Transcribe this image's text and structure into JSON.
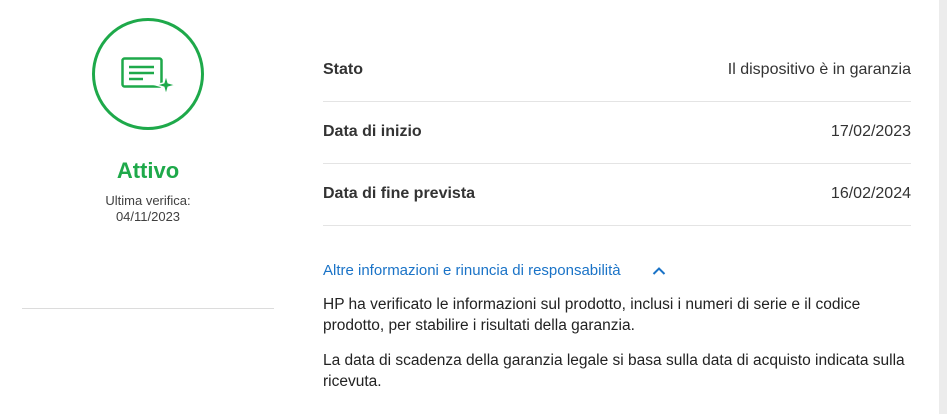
{
  "status": {
    "title": "Attivo",
    "last_check_label": "Ultima verifica:",
    "last_check_date": "04/11/2023",
    "icon": "warranty-certificate-icon",
    "accent": "#1ea94a"
  },
  "details": [
    {
      "label": "Stato",
      "value": "Il dispositivo è in garanzia"
    },
    {
      "label": "Data di inizio",
      "value": "17/02/2023"
    },
    {
      "label": "Data di fine prevista",
      "value": "16/02/2024"
    }
  ],
  "more_info": {
    "link_label": "Altre informazioni e rinuncia di responsabilità",
    "link_color": "#1a73c7",
    "icon": "chevron-up-icon",
    "paragraphs": [
      "HP ha verificato le informazioni sul prodotto, inclusi i numeri di serie e il codice prodotto, per stabilire i risultati della garanzia.",
      "La data di scadenza della garanzia legale si basa sulla data di acquisto indicata sulla ricevuta."
    ]
  }
}
